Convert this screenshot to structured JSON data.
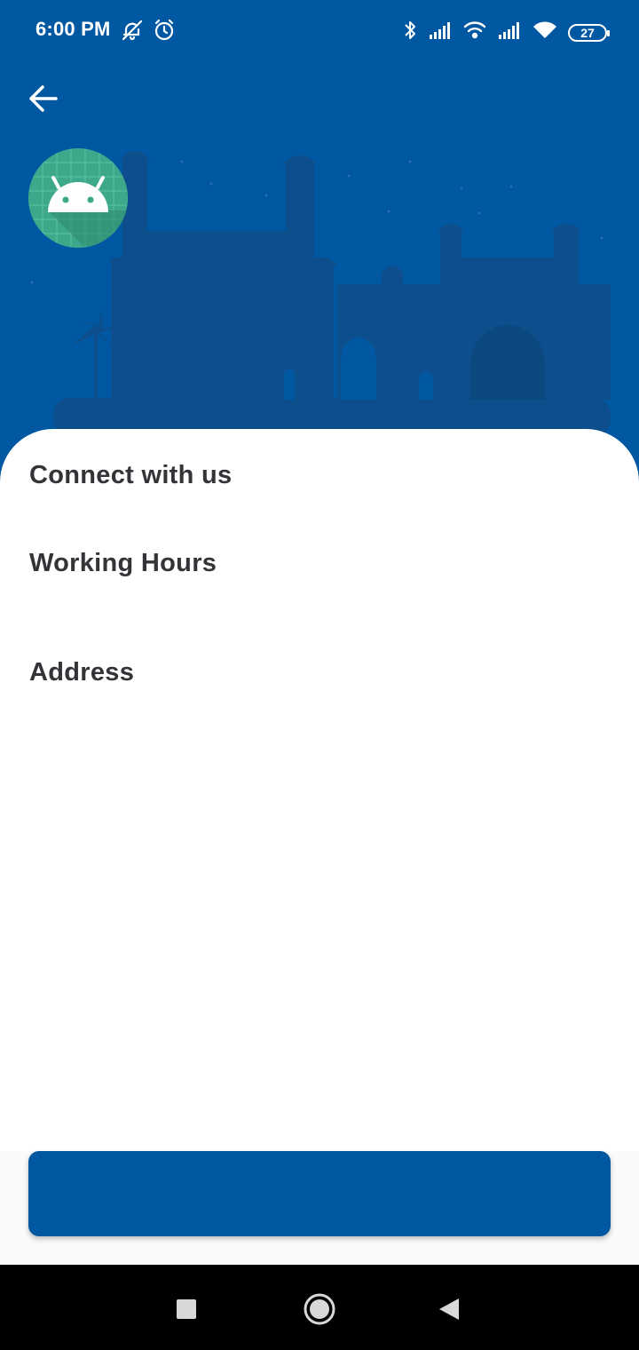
{
  "status_bar": {
    "time": "6:00 PM",
    "battery_level": "27",
    "left_icons": [
      "bell-off-icon",
      "alarm-icon"
    ],
    "right_icons": [
      "bluetooth-icon",
      "signal-icon",
      "wifi-calling-icon",
      "signal-icon",
      "wifi-icon",
      "battery-icon"
    ]
  },
  "header": {
    "back_icon": "arrow-left-icon",
    "logo_icon": "android-icon",
    "background_color": "#0058a3",
    "skyline_color": "#0d4f8c",
    "logo_color": "#3ea88a"
  },
  "sections": {
    "connect": "Connect with us",
    "working_hours": "Working Hours",
    "address": "Address"
  },
  "bottom_button": {
    "label": "",
    "color": "#0058a3"
  },
  "nav_bar": {
    "items": [
      "recent-apps-icon",
      "home-icon",
      "back-icon"
    ]
  }
}
